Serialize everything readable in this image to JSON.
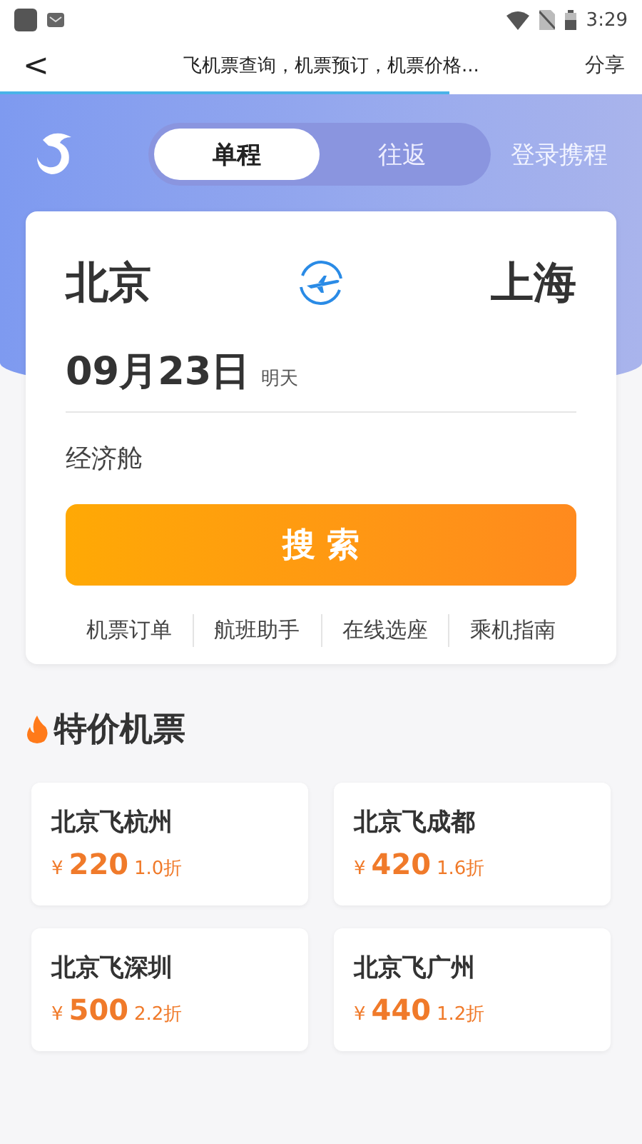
{
  "status_bar": {
    "time": "3:29"
  },
  "header": {
    "back": "<",
    "title": "飞机票查询，机票预订，机票价格...",
    "share": "分享",
    "progress": {
      "level": 0.7
    }
  },
  "banner": {
    "trip_tabs": [
      {
        "label": "单程",
        "selected": true
      },
      {
        "label": "往返",
        "selected": false
      }
    ],
    "login": "登录携程"
  },
  "search_card": {
    "from": "北京",
    "to": "上海",
    "date": "09月23日",
    "date_note": "明天",
    "cabin": "经济舱",
    "search_button": "搜 索",
    "links": [
      "机票订单",
      "航班助手",
      "在线选座",
      "乘机指南"
    ]
  },
  "deals": {
    "title": "特价机票",
    "items": [
      {
        "route": "北京飞杭州",
        "currency": "¥",
        "price": "220",
        "discount": "1.0折"
      },
      {
        "route": "北京飞成都",
        "currency": "¥",
        "price": "420",
        "discount": "1.6折"
      },
      {
        "route": "北京飞深圳",
        "currency": "¥",
        "price": "500",
        "discount": "2.2折"
      },
      {
        "route": "北京飞广州",
        "currency": "¥",
        "price": "440",
        "discount": "1.2折"
      }
    ]
  }
}
